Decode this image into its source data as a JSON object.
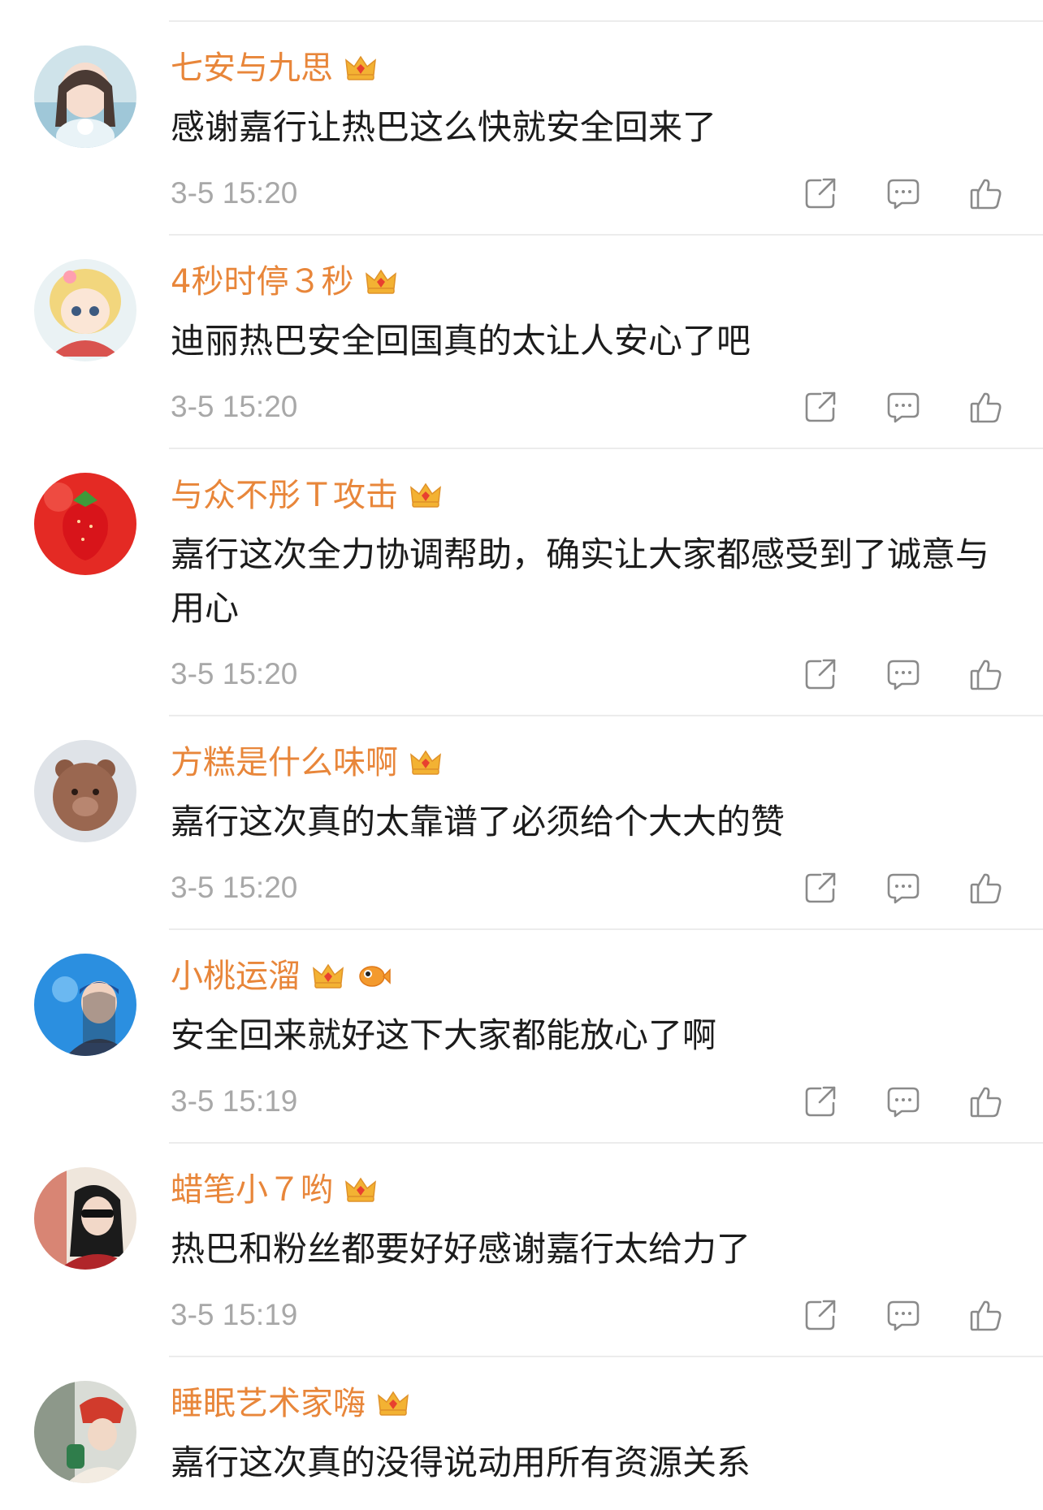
{
  "comments": [
    {
      "username": "七安与九思",
      "text": "感谢嘉行让热巴这么快就安全回来了",
      "time": "3-5 15:20",
      "badges": [
        "crown-badge-icon"
      ]
    },
    {
      "username": "4秒时停３秒",
      "text": "迪丽热巴安全回国真的太让人安心了吧",
      "time": "3-5 15:20",
      "badges": [
        "crown-badge-icon"
      ]
    },
    {
      "username": "与众不彤Ｔ攻击",
      "text": "嘉行这次全力协调帮助，确实让大家都感受到了诚意与用心",
      "time": "3-5 15:20",
      "badges": [
        "crown-badge-icon"
      ]
    },
    {
      "username": "方糕是什么味啊",
      "text": "嘉行这次真的太靠谱了必须给个大大的赞",
      "time": "3-5 15:20",
      "badges": [
        "crown-badge-icon"
      ]
    },
    {
      "username": "小桃运溜",
      "text": "安全回来就好这下大家都能放心了啊",
      "time": "3-5 15:19",
      "badges": [
        "crown-badge-icon",
        "fish-badge-icon"
      ]
    },
    {
      "username": "蜡笔小７哟",
      "text": "热巴和粉丝都要好好感谢嘉行太给力了",
      "time": "3-5 15:19",
      "badges": [
        "crown-badge-icon"
      ]
    },
    {
      "username": "睡眠艺术家嗨",
      "text": "嘉行这次真的没得说动用所有资源关系",
      "time": "",
      "badges": [
        "crown-badge-icon"
      ]
    }
  ],
  "icons": {
    "share": "share-icon",
    "reply": "comment-icon",
    "like": "thumbs-up-icon"
  },
  "colors": {
    "username": "#e8863a",
    "text": "#1c1c1c",
    "timestamp": "#a8a8a8",
    "icon": "#8a8a8a",
    "divider": "#ececec"
  }
}
